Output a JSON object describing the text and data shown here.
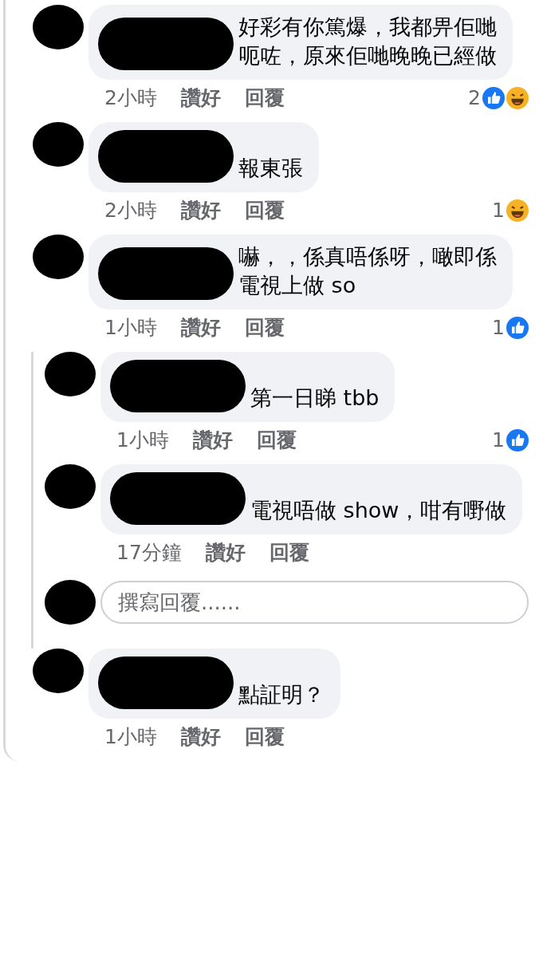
{
  "comments": [
    {
      "text": "好彩有你篤爆，我都畀佢哋呃咗，原來佢哋晚晚已經做",
      "time": "2小時",
      "like": "讚好",
      "reply": "回覆",
      "reaction_count": "2",
      "reactions": [
        {
          "kind": "like"
        },
        {
          "kind": "haha"
        }
      ]
    },
    {
      "text": "報東張",
      "time": "2小時",
      "like": "讚好",
      "reply": "回覆",
      "reaction_count": "1",
      "reactions": [
        {
          "kind": "haha"
        }
      ]
    },
    {
      "text": "嚇，，係真唔係呀，噉即係電視上做 so",
      "time": "1小時",
      "like": "讚好",
      "reply": "回覆",
      "reaction_count": "1",
      "reactions": [
        {
          "kind": "like"
        }
      ],
      "children": [
        {
          "text": "第一日睇 tbb",
          "time": "1小時",
          "like": "讚好",
          "reply": "回覆",
          "reaction_count": "1",
          "reactions": [
            {
              "kind": "like"
            }
          ]
        },
        {
          "text": "電視唔做 show，咁有嘢做",
          "time": "17分鐘",
          "like": "讚好",
          "reply": "回覆"
        }
      ],
      "reply_field": {
        "placeholder": "撰寫回覆......"
      }
    },
    {
      "text": "點証明？",
      "time": "1小時",
      "like": "讚好",
      "reply": "回覆"
    }
  ]
}
